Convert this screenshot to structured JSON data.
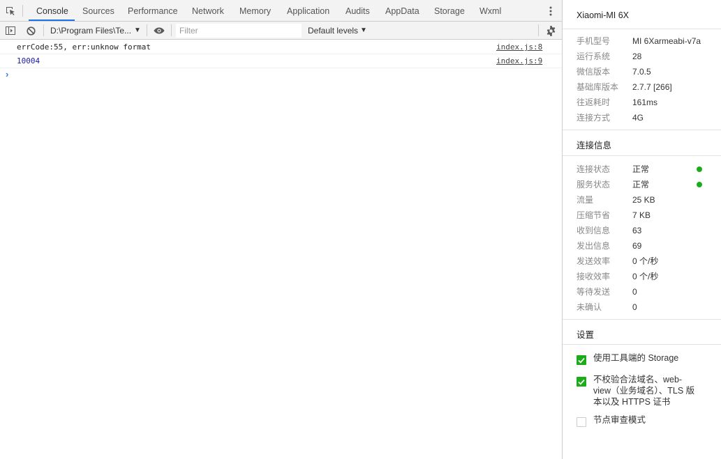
{
  "tabs": [
    {
      "label": "Console",
      "active": true
    },
    {
      "label": "Sources"
    },
    {
      "label": "Performance"
    },
    {
      "label": "Network"
    },
    {
      "label": "Memory"
    },
    {
      "label": "Application"
    },
    {
      "label": "Audits"
    },
    {
      "label": "AppData"
    },
    {
      "label": "Storage"
    },
    {
      "label": "Wxml"
    }
  ],
  "toolbar": {
    "context": "D:\\Program Files\\Te...",
    "filter_placeholder": "Filter",
    "filter_value": "",
    "levels": "Default levels"
  },
  "console": {
    "messages": [
      {
        "text": "errCode:55, err:unknow format",
        "source": "index.js:8",
        "kind": "string"
      },
      {
        "text": "10004",
        "source": "index.js:9",
        "kind": "number"
      }
    ],
    "prompt": "›"
  },
  "device": {
    "name": "Xiaomi-MI 6X",
    "info": [
      {
        "label": "手机型号",
        "value": "MI 6Xarmeabi-v7a"
      },
      {
        "label": "运行系统",
        "value": "28"
      },
      {
        "label": "微信版本",
        "value": "7.0.5"
      },
      {
        "label": "基础库版本",
        "value": "2.7.7 [266]"
      },
      {
        "label": "往返耗时",
        "value": "161ms"
      },
      {
        "label": "连接方式",
        "value": "4G"
      }
    ]
  },
  "connection": {
    "title": "连接信息",
    "items": [
      {
        "label": "连接状态",
        "value": "正常",
        "dot": true
      },
      {
        "label": "服务状态",
        "value": "正常",
        "dot": true
      },
      {
        "label": "流量",
        "value": "25 KB"
      },
      {
        "label": "压缩节省",
        "value": "7 KB"
      },
      {
        "label": "收到信息",
        "value": "63"
      },
      {
        "label": "发出信息",
        "value": "69"
      },
      {
        "label": "发送效率",
        "value": "0 个/秒"
      },
      {
        "label": "接收效率",
        "value": "0 个/秒"
      },
      {
        "label": "等待发送",
        "value": "0"
      },
      {
        "label": "未确认",
        "value": "0"
      }
    ],
    "status_color": "#1aad19"
  },
  "settings": {
    "title": "设置",
    "items": [
      {
        "label_lines": [
          "使用工具端的 Storage"
        ],
        "checked": true
      },
      {
        "label_lines": [
          "不校验合法域名、web-",
          "view（业务域名）、TLS 版",
          "本以及 HTTPS 证书"
        ],
        "checked": true
      },
      {
        "label_lines": [
          "节点审查模式"
        ],
        "checked": false
      }
    ]
  },
  "colors": {
    "accent": "#1a73e8",
    "check_green": "#1aad19",
    "number": "#1a1aa6"
  }
}
